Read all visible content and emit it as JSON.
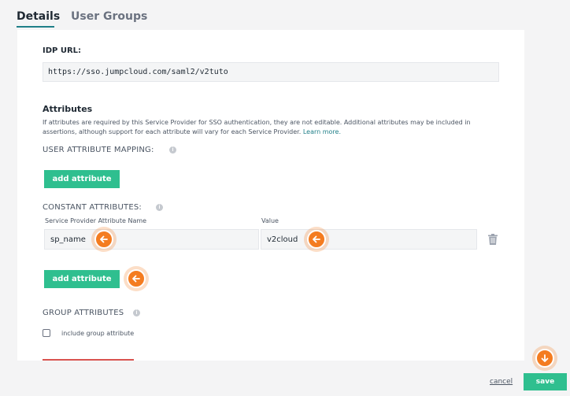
{
  "tabs": [
    {
      "label": "Details"
    },
    {
      "label": "User Groups"
    }
  ],
  "idp": {
    "label": "IDP URL:",
    "value": "https://sso.jumpcloud.com/saml2/v2tuto"
  },
  "attributes": {
    "title": "Attributes",
    "description": "If attributes are required by this Service Provider for SSO authentication, they are not editable. Additional attributes may be included in assertions, although support for each attribute will vary for each Service Provider.",
    "learn_more": "Learn more."
  },
  "user_mapping": {
    "label": "USER ATTRIBUTE MAPPING:",
    "add_label": "add attribute"
  },
  "constant": {
    "label": "CONSTANT ATTRIBUTES:",
    "name_col": "Service Provider Attribute Name",
    "value_col": "Value",
    "name_value": "sp_name",
    "value_value": "v2cloud",
    "add_label": "add attribute"
  },
  "group": {
    "label": "GROUP ATTRIBUTES",
    "checkbox_label": "include group attribute"
  },
  "footer": {
    "cancel_label": "cancel",
    "save_label": "save"
  },
  "colors": {
    "accent": "#2fbf8f",
    "hint": "#f47c20",
    "tab_underline": "#1f7f88"
  }
}
